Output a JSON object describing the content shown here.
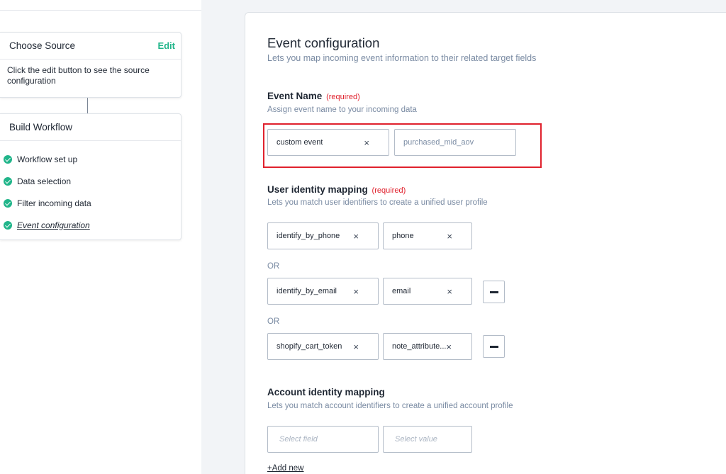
{
  "sidebar": {
    "choose_source": {
      "title": "Choose Source",
      "edit_label": "Edit",
      "description": "Click the edit button to see the source configuration"
    },
    "build_workflow": {
      "title": "Build Workflow",
      "steps": [
        {
          "label": "Workflow set up",
          "status": "complete"
        },
        {
          "label": "Data selection",
          "status": "complete"
        },
        {
          "label": "Filter incoming data",
          "status": "complete"
        },
        {
          "label": "Event configuration",
          "status": "current"
        }
      ]
    }
  },
  "main": {
    "title": "Event configuration",
    "subtitle": "Lets you map incoming event information to their related target fields",
    "event_name": {
      "title": "Event Name",
      "required": "(required)",
      "subtitle": "Assign event name to your incoming data",
      "type_value": "custom event",
      "name_value": "purchased_mid_aov"
    },
    "user_identity": {
      "title": "User identity mapping",
      "required": "(required)",
      "subtitle": "Lets you match user identifiers to create a unified user profile",
      "or_label": "OR",
      "rows": [
        {
          "field": "identify_by_phone",
          "value": "phone"
        },
        {
          "field": "identify_by_email",
          "value": "email"
        },
        {
          "field": "shopify_cart_token",
          "value": "note_attribute..."
        }
      ]
    },
    "account_identity": {
      "title": "Account identity mapping",
      "subtitle": "Lets you match account identifiers to create a unified account profile",
      "field_placeholder": "Select field",
      "value_placeholder": "Select value"
    },
    "add_new_label": "+Add new"
  },
  "icons": {
    "clear": "×",
    "remove": "minus-icon",
    "check": "check-icon"
  },
  "colors": {
    "accent": "#21b58a",
    "required": "#e0212d",
    "highlight": "#e0212d"
  }
}
